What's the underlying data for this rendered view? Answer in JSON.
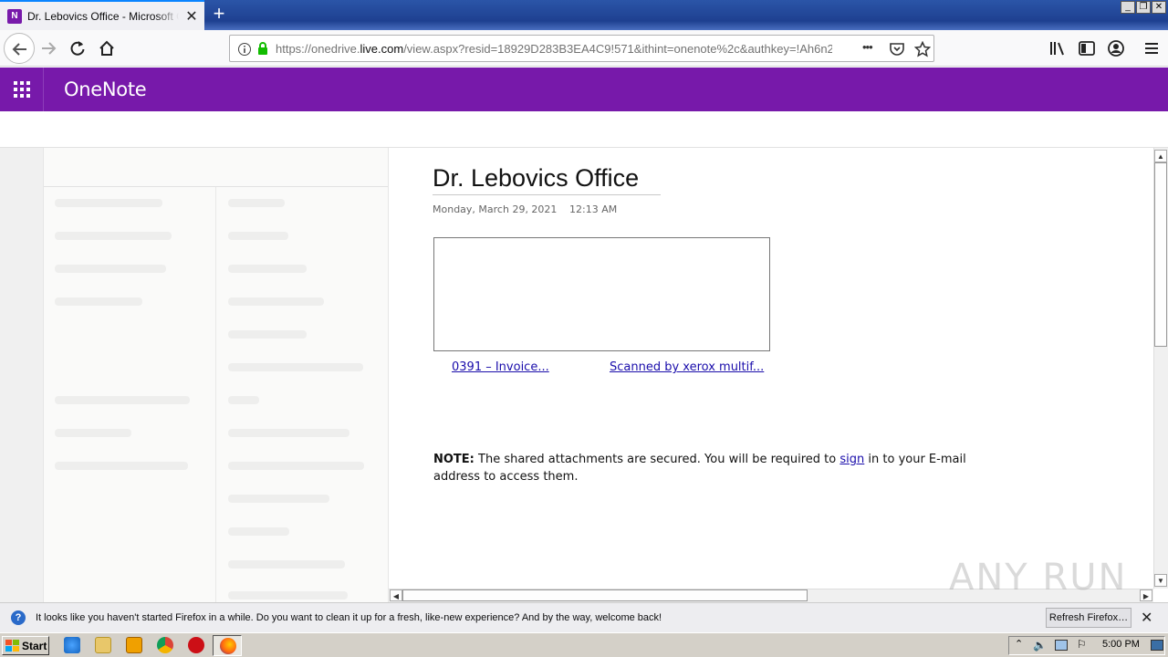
{
  "browser": {
    "tab_title": "Dr. Lebovics Office - Microsoft OneNote Online",
    "tab_favicon_label": "N",
    "new_tab_symbol": "+",
    "url_prefix": "https://onedrive.",
    "url_domain": "live.com",
    "url_rest": "/view.aspx?resid=18929D283B3EA4C9!571&ithint=onenote%2c&authkey=!Ah6n2",
    "page_actions_symbol": "•••",
    "window_controls": [
      "_",
      "❐",
      "✕"
    ]
  },
  "onenote": {
    "app_name": "OneNote"
  },
  "page": {
    "title": "Dr. Lebovics Office",
    "date": "Monday, March 29, 2021",
    "time": "12:13 AM",
    "attachments": [
      "0391 – Invoice...",
      "Scanned by xerox multif..."
    ],
    "note_label": "NOTE:",
    "note_text_before": " The shared attachments are secured. You will be required to ",
    "note_link": "sign",
    "note_text_after": " in to your E-mail address to access them."
  },
  "notification": {
    "message": "It looks like you haven't started Firefox in a while. Do you want to clean it up for a fresh, like-new experience? And by the way, welcome back!",
    "button": "Refresh Firefox…",
    "close": "✕"
  },
  "taskbar": {
    "start_label": "Start",
    "clock": "5:00 PM"
  },
  "watermark": "ANY RUN",
  "colors": {
    "onenote_purple": "#7719aa",
    "link_blue": "#1a0dab",
    "titlebar_blue": "#1e4090"
  }
}
